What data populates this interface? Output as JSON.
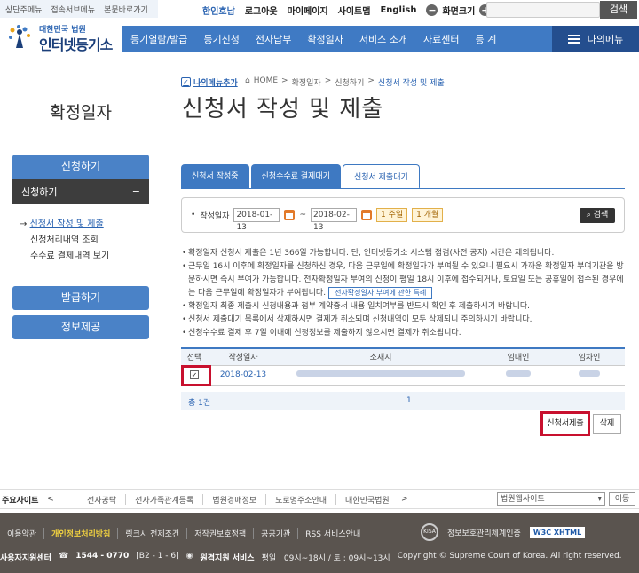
{
  "skip_links": [
    "상단주메뉴",
    "접속서브메뉴",
    "본문바로가기"
  ],
  "util": {
    "home": "한인호남",
    "logout": "로그아웃",
    "mypage": "마이페이지",
    "sitemap": "사이트맵",
    "english": "English",
    "zoom_minus": "−",
    "zoom_label": "화면크기",
    "zoom_plus": "+",
    "search_btn": "검색"
  },
  "logo": {
    "sub": "대한민국 법원",
    "main": "인터넷등기소"
  },
  "gnb": {
    "items": [
      "등기열람/발급",
      "등기신청",
      "전자납부",
      "확정일자",
      "서비스 소개",
      "자료센터",
      "등 계"
    ],
    "mymenu": "나의메뉴"
  },
  "lnb": {
    "title": "확정일자",
    "main1": "신청하기",
    "sub": "신청하기",
    "sub_toggle": "−",
    "links": [
      "신청서 작성 및 제출",
      "신청처리내역 조회",
      "수수료 결제내역 보기"
    ],
    "main2": "발급하기",
    "main3": "정보제공"
  },
  "content": {
    "mymenu_add": "나의메뉴추가",
    "breadcrumb": [
      "HOME",
      ">",
      "확정일자",
      ">",
      "신청하기",
      ">",
      "신청서 작성 및 제출"
    ],
    "title": "신청서 작성 및 제출",
    "tabs": [
      "신청서 작성중",
      "신청수수료 결제대기",
      "신청서 제출대기"
    ],
    "filter": {
      "label": "작성일자",
      "from": "2018-01-13",
      "tilde": "~",
      "to": "2018-02-13",
      "week": "1 주일",
      "month": "1 개월",
      "search": "검색"
    },
    "notice": [
      "확정일자 신청서 제출은 1년 366일 가능합니다. 단, 인터넷등기소 시스템 점검(사전 공지) 시간은 제외됩니다.",
      "근무일 16시 이후에 확정일자를 신청하신 경우, 다음 근무일에 확정일자가 부여될 수 있으니 필요시 가까운 확정일자 부여기관을 방문하시면 즉시 부여가 가능합니다. 전자확정일자 부여의 신청이 평일 18시 이후에 접수되거나, 토요일 또는 공휴일에 접수된 경우에는 다음 근무일에 확정일자가 부여됩니다.",
      "확정일자 최종 제출시 신청내용과 첨부 계약증서 내용 일치여부를 반드시 확인 후 제출하시기 바랍니다.",
      "신청서 제출대기 목록에서 삭제하시면 결제가 취소되며 신청내역이 모두 삭제되니 주의하시기 바랍니다.",
      "신청수수료 결제 후 7일 이내에 신청정보를 제출하지 않으시면 결제가 취소됩니다."
    ],
    "rule_btn": "전자확정일자 부여에 관한 특례",
    "table": {
      "headers": [
        "선택",
        "작성일자",
        "소재지",
        "임대인",
        "임차인"
      ],
      "row": {
        "checked": "✓",
        "date": "2018-02-13"
      }
    },
    "pager": {
      "count": "총 1건",
      "page": "1"
    },
    "submit": "신청서제출",
    "delete": "삭제"
  },
  "footer": {
    "sites_label": "주요사이트",
    "prev": "<",
    "next": ">",
    "sites": [
      "전자공탁",
      "전자가족관계등록",
      "법원경매정보",
      "도로명주소안내",
      "대한민국법원"
    ],
    "select": "법원웹사이트",
    "go": "이동",
    "links": [
      "이용약관",
      "개인정보처리방침",
      "링크시 전제조건",
      "저작권보호정책",
      "공공기관",
      "RSS 서비스안내"
    ],
    "kisa": "KISA",
    "isms": "정보보호관리체계인증",
    "w3c": "W3C XHTML",
    "contact_label": "사용자지원센터",
    "phone": "1544 - 0770",
    "phone_opts": "[B2 - 1 - 6]",
    "remote": "원격지원 서비스",
    "hours": "평일 : 09시~18시 / 토 : 09시~13시",
    "copyright": "Copyright © Supreme Court of Korea.  All right reserved."
  }
}
